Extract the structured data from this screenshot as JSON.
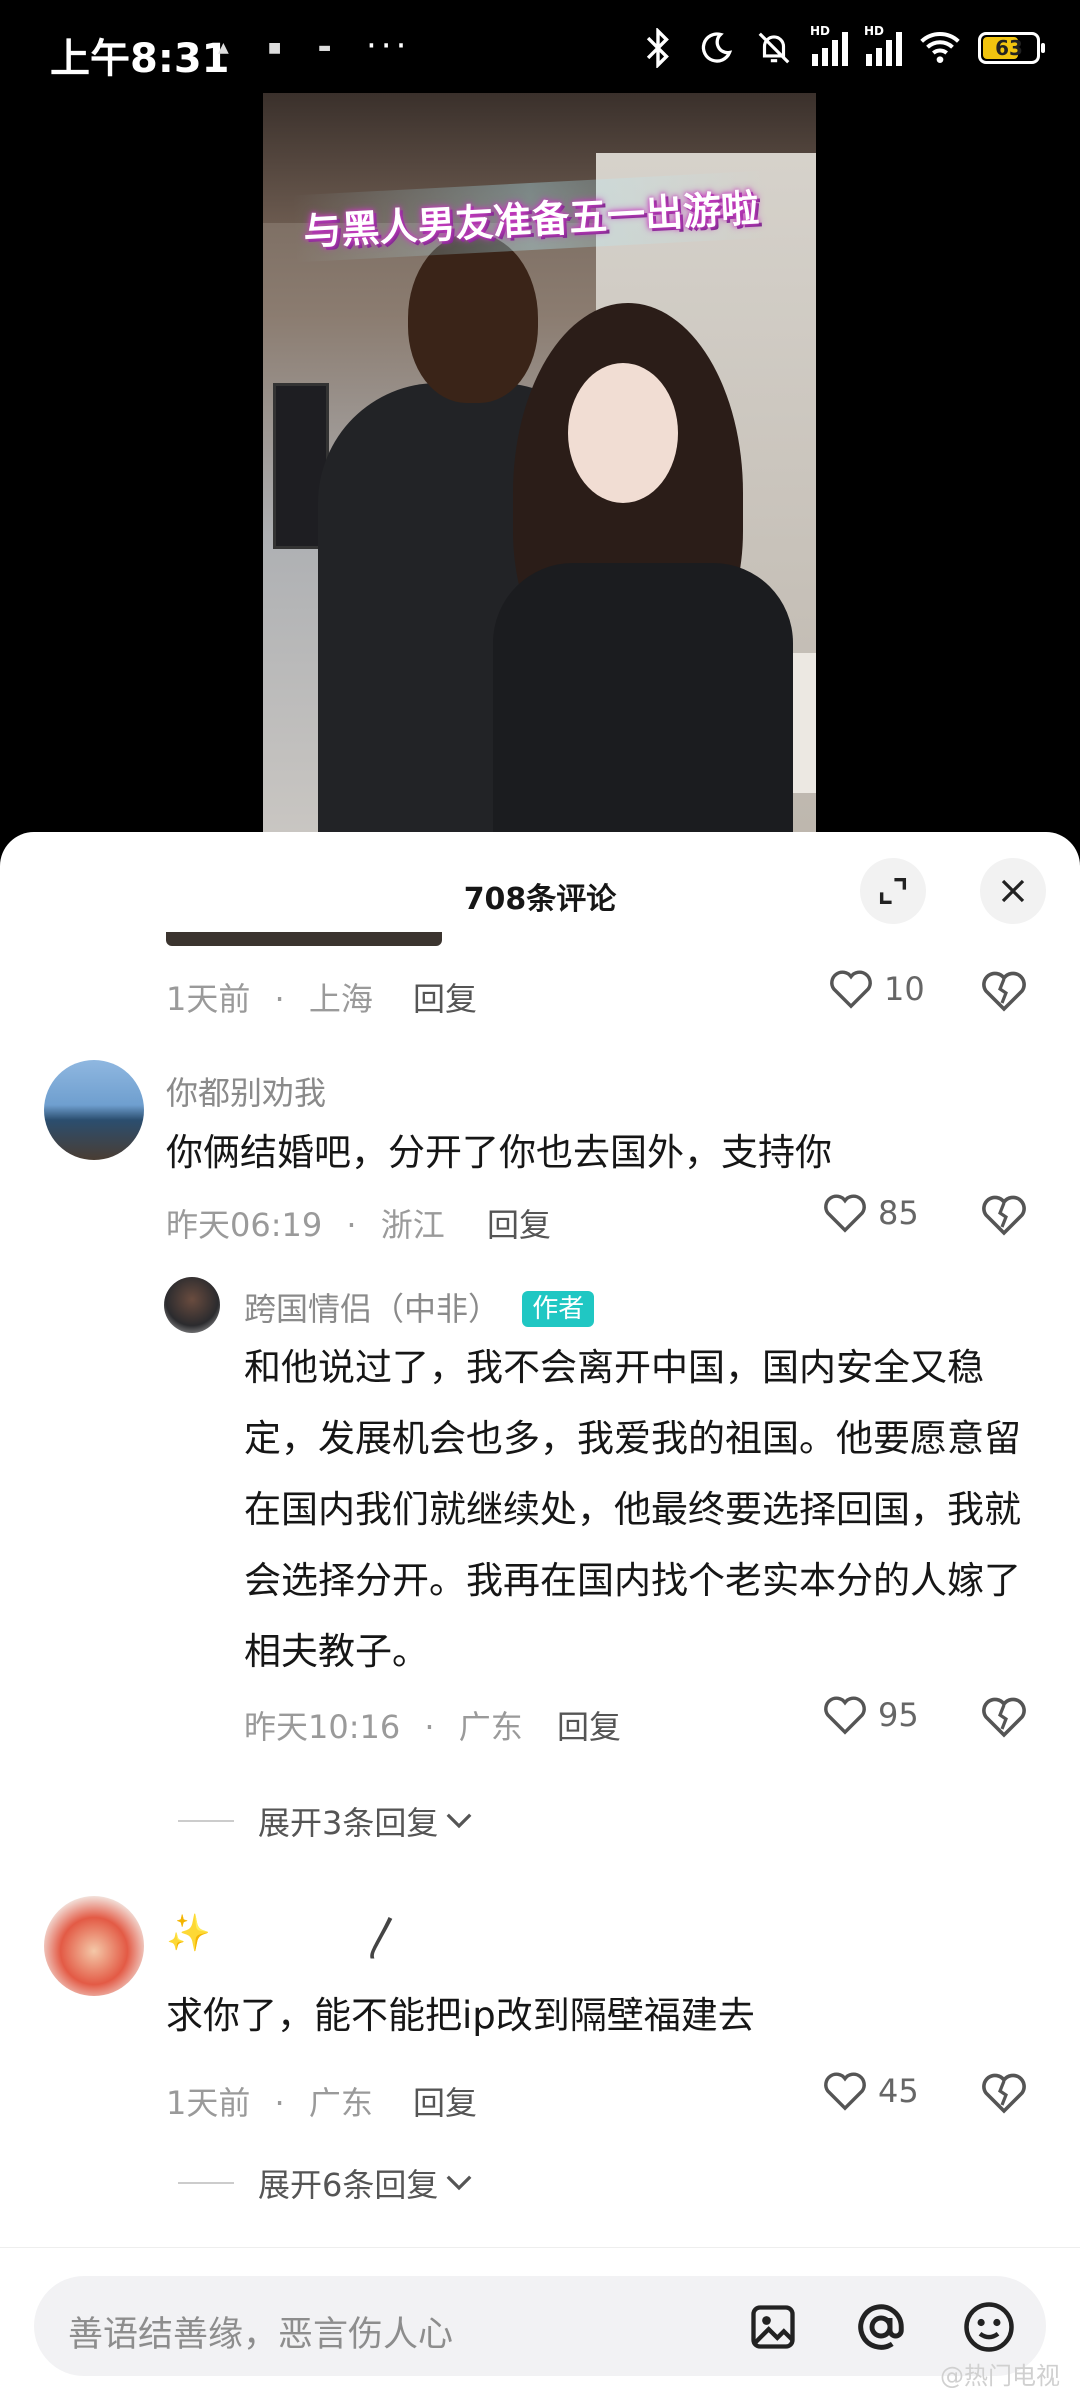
{
  "status_bar": {
    "time": "上午8:31",
    "more": "···",
    "battery": "63",
    "battery_level": 0.63
  },
  "video": {
    "overlay_title": "与黑人男友准备五一出游啦"
  },
  "comments_panel": {
    "title": "708条评论"
  },
  "comments": [
    {
      "time": "1天前",
      "location": "上海",
      "reply_label": "回复",
      "likes": "10"
    },
    {
      "username": "你都别劝我",
      "text": "你俩结婚吧，分开了你也去国外，支持你",
      "time": "昨天06:19",
      "location": "浙江",
      "reply_label": "回复",
      "likes": "85"
    },
    {
      "username": "跨国情侣（中非）",
      "tag": "作者",
      "text": "和他说过了，我不会离开中国，国内安全又稳定，发展机会也多，我爱我的祖国。他要愿意留在国内我们就继续处，他最终要选择回国，我就会选择分开。我再在国内找个老实本分的人嫁了相夫教子。",
      "time": "昨天10:16",
      "location": "广东",
      "reply_label": "回复",
      "likes": "95",
      "expand_label": "展开3条回复"
    },
    {
      "text": "求你了，能不能把ip改到隔壁福建去",
      "time": "1天前",
      "location": "广东",
      "reply_label": "回复",
      "likes": "45",
      "expand_label": "展开6条回复"
    }
  ],
  "sep": "·",
  "input": {
    "placeholder": "善语结善缘，恶言伤人心"
  },
  "watermark": "@热门电视"
}
